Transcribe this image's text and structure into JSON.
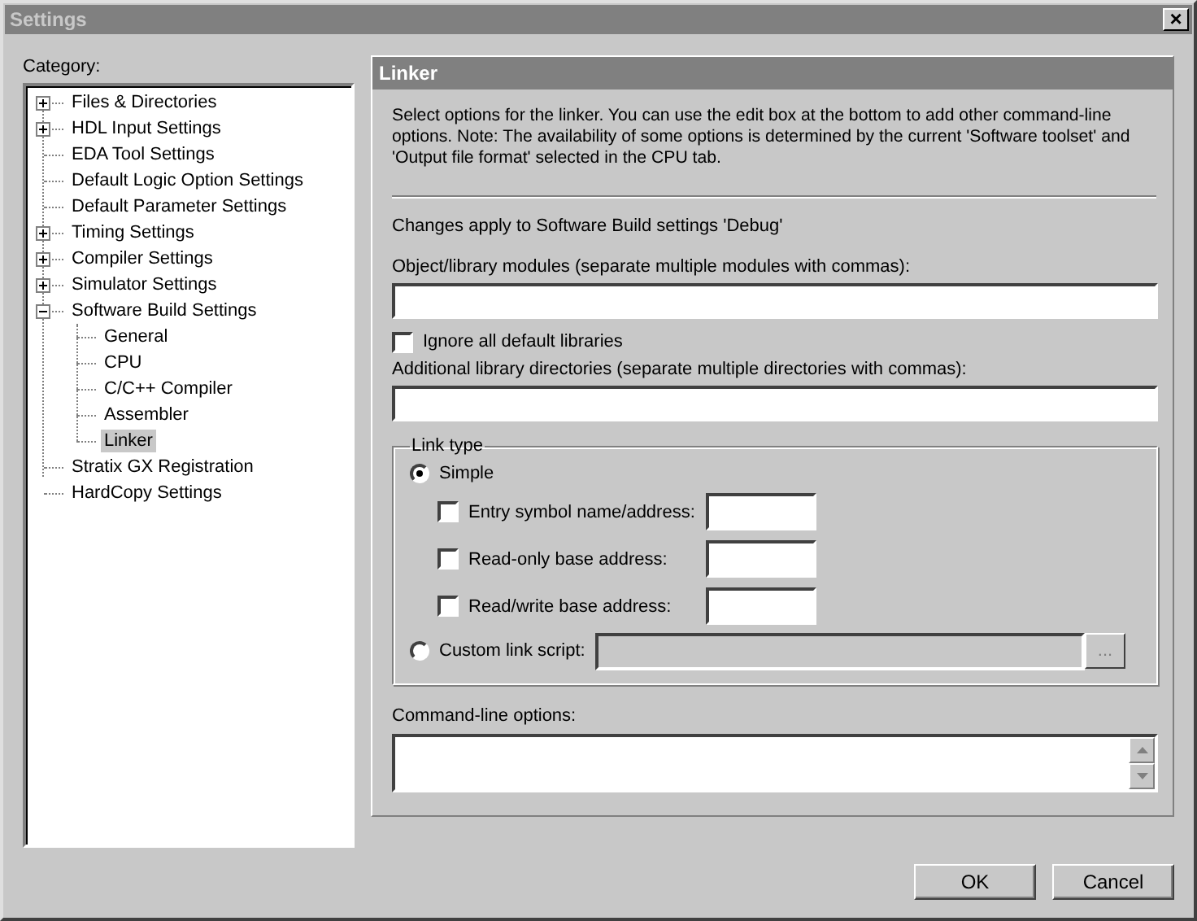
{
  "window": {
    "title": "Settings",
    "close": "×"
  },
  "category_label": "Category:",
  "tree": [
    {
      "label": "Files & Directories",
      "kind": "node",
      "expanded": false,
      "selected": false
    },
    {
      "label": "HDL Input Settings",
      "kind": "node",
      "expanded": false,
      "selected": false
    },
    {
      "label": "EDA Tool Settings",
      "kind": "leaf",
      "selected": false
    },
    {
      "label": "Default Logic Option Settings",
      "kind": "leaf",
      "selected": false
    },
    {
      "label": "Default Parameter Settings",
      "kind": "leaf",
      "selected": false
    },
    {
      "label": "Timing Settings",
      "kind": "node",
      "expanded": false,
      "selected": false
    },
    {
      "label": "Compiler Settings",
      "kind": "node",
      "expanded": false,
      "selected": false
    },
    {
      "label": "Simulator Settings",
      "kind": "node",
      "expanded": false,
      "selected": false
    },
    {
      "label": "Software Build Settings",
      "kind": "node",
      "expanded": true,
      "selected": false,
      "children": [
        {
          "label": "General",
          "selected": false
        },
        {
          "label": "CPU",
          "selected": false
        },
        {
          "label": "C/C++ Compiler",
          "selected": false
        },
        {
          "label": "Assembler",
          "selected": false
        },
        {
          "label": "Linker",
          "selected": true
        }
      ]
    },
    {
      "label": "Stratix GX Registration",
      "kind": "leaf",
      "selected": false
    },
    {
      "label": "HardCopy Settings",
      "kind": "leaf",
      "selected": false
    }
  ],
  "panel": {
    "title": "Linker",
    "description": "Select options for the linker. You can use the edit box at the bottom to add other command-line options. Note: The availability of some options is determined by the current 'Software toolset' and 'Output file format' selected in the CPU tab.",
    "applies_to": "Changes apply to Software Build settings 'Debug'",
    "modules_label": "Object/library modules (separate multiple modules with commas):",
    "ignore_default_libraries": {
      "label": "Ignore all default libraries",
      "checked": false
    },
    "directories_label": "Additional library directories (separate multiple directories with commas):",
    "link_type": {
      "title": "Link type",
      "simple": {
        "label": "Simple",
        "selected": true
      },
      "options": [
        {
          "label": "Entry symbol name/address:",
          "checked": false
        },
        {
          "label": "Read-only base address:",
          "checked": false
        },
        {
          "label": "Read/write base address:",
          "checked": false
        }
      ],
      "custom": {
        "label": "Custom link script:",
        "selected": false,
        "browse": "..."
      }
    },
    "command_line_label": "Command-line options:"
  },
  "buttons": [
    "OK",
    "Cancel"
  ]
}
